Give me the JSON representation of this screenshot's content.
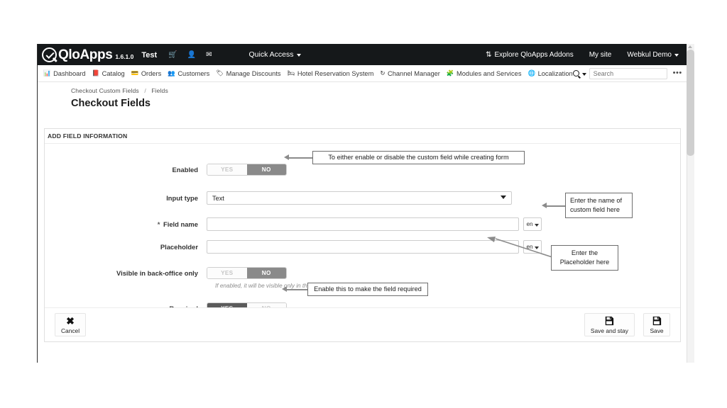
{
  "header": {
    "brand_name": "QloApps",
    "version": "1.6.1.0",
    "shop_name": "Test",
    "icons": [
      {
        "name": "cart-icon",
        "glyph": "🛒"
      },
      {
        "name": "user-icon",
        "glyph": "👤"
      },
      {
        "name": "envelope-icon",
        "glyph": "✉"
      }
    ],
    "quick_access": "Quick Access",
    "explore_addons": "Explore QloApps Addons",
    "my_site": "My site",
    "account": "Webkul Demo"
  },
  "menu": {
    "items": [
      {
        "label": "Dashboard",
        "icon": "dashboard-icon",
        "glyph": "📊"
      },
      {
        "label": "Catalog",
        "icon": "catalog-icon",
        "glyph": "📕"
      },
      {
        "label": "Orders",
        "icon": "orders-icon",
        "glyph": "💳"
      },
      {
        "label": "Customers",
        "icon": "customers-icon",
        "glyph": "👥"
      },
      {
        "label": "Manage Discounts",
        "icon": "discount-tag-icon",
        "glyph": "🏷"
      },
      {
        "label": "Hotel Reservation System",
        "icon": "bed-icon",
        "glyph": "🛏"
      },
      {
        "label": "Channel Manager",
        "icon": "refresh-icon",
        "glyph": "↻"
      },
      {
        "label": "Modules and Services",
        "icon": "modules-icon",
        "glyph": "🧩"
      },
      {
        "label": "Localization",
        "icon": "globe-icon",
        "glyph": "🌐"
      }
    ],
    "search_placeholder": "Search",
    "kebab": "•••"
  },
  "breadcrumb": {
    "parent": "Checkout Custom Fields",
    "separator": "/",
    "current": "Fields"
  },
  "page_title": "Checkout Fields",
  "panel": {
    "title": "ADD FIELD INFORMATION",
    "rows": {
      "enabled": {
        "label": "Enabled",
        "yes": "YES",
        "no": "NO",
        "selected": "NO"
      },
      "input_type": {
        "label": "Input type",
        "value": "Text"
      },
      "field_name": {
        "label": "Field name",
        "required_mark": "*",
        "value": "",
        "lang": "en"
      },
      "placeholder": {
        "label": "Placeholder",
        "value": "",
        "lang": "en"
      },
      "visible_back_office": {
        "label": "Visible in back-office only",
        "yes": "YES",
        "no": "NO",
        "selected": "NO",
        "helper": "If enabled, it will be visible only in the back office."
      },
      "required": {
        "label": "Required",
        "yes": "YES",
        "no": "NO",
        "selected": "YES"
      }
    },
    "footer": {
      "cancel": "Cancel",
      "save_and_stay": "Save and stay",
      "save": "Save"
    }
  },
  "annotations": {
    "enabled": "To either enable or disable the custom field while creating form",
    "field_name_line1": "Enter the name of",
    "field_name_line2": "custom field here",
    "placeholder_line1": "Enter the",
    "placeholder_line2": "Placeholder here",
    "required": "Enable this to make the field required"
  },
  "colors": {
    "topbar": "#15181a",
    "toggle_active": "#8a8a8a",
    "toggle_active_dark": "#5b5b5b",
    "annotation_border": "#6e6e6e"
  }
}
